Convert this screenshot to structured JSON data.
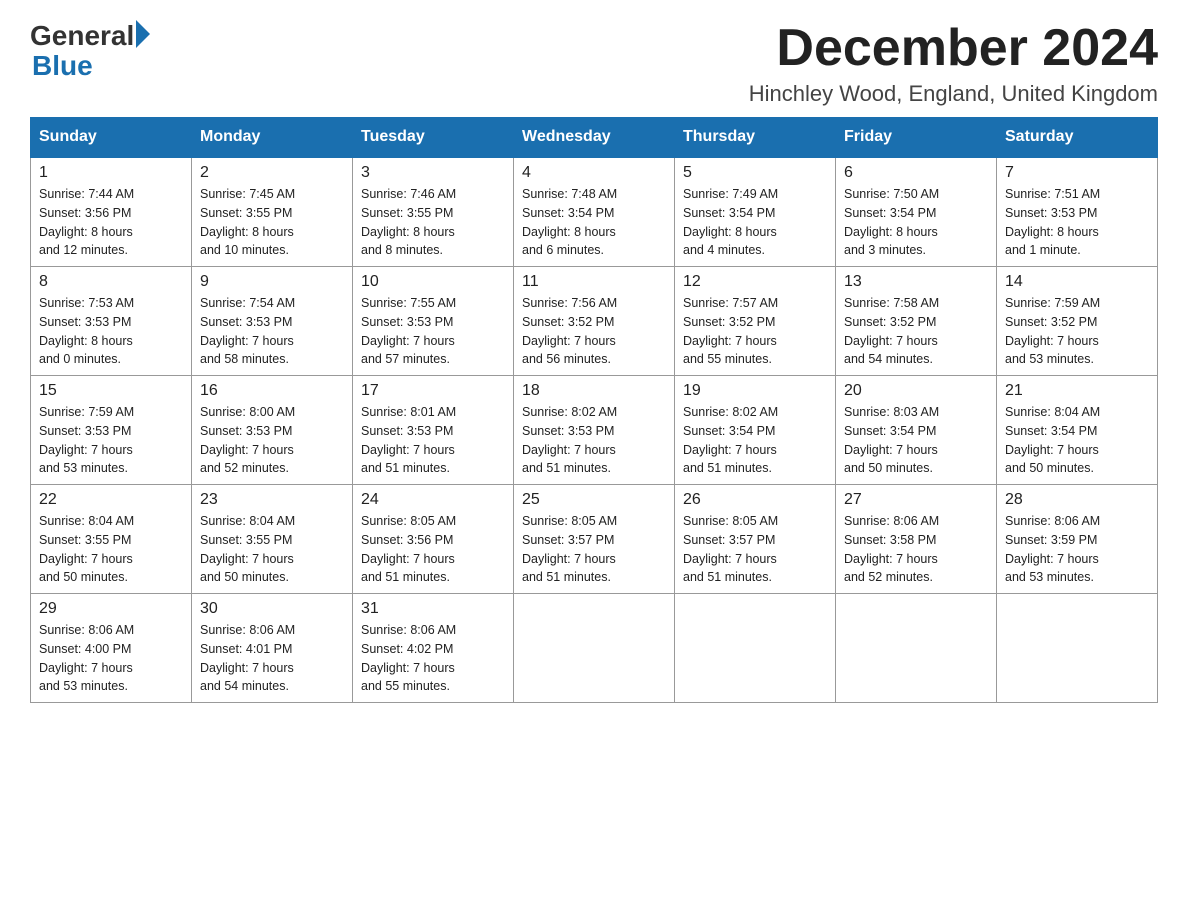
{
  "header": {
    "logo": {
      "general": "General",
      "blue": "Blue"
    },
    "title": "December 2024",
    "location": "Hinchley Wood, England, United Kingdom"
  },
  "columns": [
    "Sunday",
    "Monday",
    "Tuesday",
    "Wednesday",
    "Thursday",
    "Friday",
    "Saturday"
  ],
  "weeks": [
    [
      {
        "day": "1",
        "sunrise": "Sunrise: 7:44 AM",
        "sunset": "Sunset: 3:56 PM",
        "daylight": "Daylight: 8 hours",
        "daylight2": "and 12 minutes."
      },
      {
        "day": "2",
        "sunrise": "Sunrise: 7:45 AM",
        "sunset": "Sunset: 3:55 PM",
        "daylight": "Daylight: 8 hours",
        "daylight2": "and 10 minutes."
      },
      {
        "day": "3",
        "sunrise": "Sunrise: 7:46 AM",
        "sunset": "Sunset: 3:55 PM",
        "daylight": "Daylight: 8 hours",
        "daylight2": "and 8 minutes."
      },
      {
        "day": "4",
        "sunrise": "Sunrise: 7:48 AM",
        "sunset": "Sunset: 3:54 PM",
        "daylight": "Daylight: 8 hours",
        "daylight2": "and 6 minutes."
      },
      {
        "day": "5",
        "sunrise": "Sunrise: 7:49 AM",
        "sunset": "Sunset: 3:54 PM",
        "daylight": "Daylight: 8 hours",
        "daylight2": "and 4 minutes."
      },
      {
        "day": "6",
        "sunrise": "Sunrise: 7:50 AM",
        "sunset": "Sunset: 3:54 PM",
        "daylight": "Daylight: 8 hours",
        "daylight2": "and 3 minutes."
      },
      {
        "day": "7",
        "sunrise": "Sunrise: 7:51 AM",
        "sunset": "Sunset: 3:53 PM",
        "daylight": "Daylight: 8 hours",
        "daylight2": "and 1 minute."
      }
    ],
    [
      {
        "day": "8",
        "sunrise": "Sunrise: 7:53 AM",
        "sunset": "Sunset: 3:53 PM",
        "daylight": "Daylight: 8 hours",
        "daylight2": "and 0 minutes."
      },
      {
        "day": "9",
        "sunrise": "Sunrise: 7:54 AM",
        "sunset": "Sunset: 3:53 PM",
        "daylight": "Daylight: 7 hours",
        "daylight2": "and 58 minutes."
      },
      {
        "day": "10",
        "sunrise": "Sunrise: 7:55 AM",
        "sunset": "Sunset: 3:53 PM",
        "daylight": "Daylight: 7 hours",
        "daylight2": "and 57 minutes."
      },
      {
        "day": "11",
        "sunrise": "Sunrise: 7:56 AM",
        "sunset": "Sunset: 3:52 PM",
        "daylight": "Daylight: 7 hours",
        "daylight2": "and 56 minutes."
      },
      {
        "day": "12",
        "sunrise": "Sunrise: 7:57 AM",
        "sunset": "Sunset: 3:52 PM",
        "daylight": "Daylight: 7 hours",
        "daylight2": "and 55 minutes."
      },
      {
        "day": "13",
        "sunrise": "Sunrise: 7:58 AM",
        "sunset": "Sunset: 3:52 PM",
        "daylight": "Daylight: 7 hours",
        "daylight2": "and 54 minutes."
      },
      {
        "day": "14",
        "sunrise": "Sunrise: 7:59 AM",
        "sunset": "Sunset: 3:52 PM",
        "daylight": "Daylight: 7 hours",
        "daylight2": "and 53 minutes."
      }
    ],
    [
      {
        "day": "15",
        "sunrise": "Sunrise: 7:59 AM",
        "sunset": "Sunset: 3:53 PM",
        "daylight": "Daylight: 7 hours",
        "daylight2": "and 53 minutes."
      },
      {
        "day": "16",
        "sunrise": "Sunrise: 8:00 AM",
        "sunset": "Sunset: 3:53 PM",
        "daylight": "Daylight: 7 hours",
        "daylight2": "and 52 minutes."
      },
      {
        "day": "17",
        "sunrise": "Sunrise: 8:01 AM",
        "sunset": "Sunset: 3:53 PM",
        "daylight": "Daylight: 7 hours",
        "daylight2": "and 51 minutes."
      },
      {
        "day": "18",
        "sunrise": "Sunrise: 8:02 AM",
        "sunset": "Sunset: 3:53 PM",
        "daylight": "Daylight: 7 hours",
        "daylight2": "and 51 minutes."
      },
      {
        "day": "19",
        "sunrise": "Sunrise: 8:02 AM",
        "sunset": "Sunset: 3:54 PM",
        "daylight": "Daylight: 7 hours",
        "daylight2": "and 51 minutes."
      },
      {
        "day": "20",
        "sunrise": "Sunrise: 8:03 AM",
        "sunset": "Sunset: 3:54 PM",
        "daylight": "Daylight: 7 hours",
        "daylight2": "and 50 minutes."
      },
      {
        "day": "21",
        "sunrise": "Sunrise: 8:04 AM",
        "sunset": "Sunset: 3:54 PM",
        "daylight": "Daylight: 7 hours",
        "daylight2": "and 50 minutes."
      }
    ],
    [
      {
        "day": "22",
        "sunrise": "Sunrise: 8:04 AM",
        "sunset": "Sunset: 3:55 PM",
        "daylight": "Daylight: 7 hours",
        "daylight2": "and 50 minutes."
      },
      {
        "day": "23",
        "sunrise": "Sunrise: 8:04 AM",
        "sunset": "Sunset: 3:55 PM",
        "daylight": "Daylight: 7 hours",
        "daylight2": "and 50 minutes."
      },
      {
        "day": "24",
        "sunrise": "Sunrise: 8:05 AM",
        "sunset": "Sunset: 3:56 PM",
        "daylight": "Daylight: 7 hours",
        "daylight2": "and 51 minutes."
      },
      {
        "day": "25",
        "sunrise": "Sunrise: 8:05 AM",
        "sunset": "Sunset: 3:57 PM",
        "daylight": "Daylight: 7 hours",
        "daylight2": "and 51 minutes."
      },
      {
        "day": "26",
        "sunrise": "Sunrise: 8:05 AM",
        "sunset": "Sunset: 3:57 PM",
        "daylight": "Daylight: 7 hours",
        "daylight2": "and 51 minutes."
      },
      {
        "day": "27",
        "sunrise": "Sunrise: 8:06 AM",
        "sunset": "Sunset: 3:58 PM",
        "daylight": "Daylight: 7 hours",
        "daylight2": "and 52 minutes."
      },
      {
        "day": "28",
        "sunrise": "Sunrise: 8:06 AM",
        "sunset": "Sunset: 3:59 PM",
        "daylight": "Daylight: 7 hours",
        "daylight2": "and 53 minutes."
      }
    ],
    [
      {
        "day": "29",
        "sunrise": "Sunrise: 8:06 AM",
        "sunset": "Sunset: 4:00 PM",
        "daylight": "Daylight: 7 hours",
        "daylight2": "and 53 minutes."
      },
      {
        "day": "30",
        "sunrise": "Sunrise: 8:06 AM",
        "sunset": "Sunset: 4:01 PM",
        "daylight": "Daylight: 7 hours",
        "daylight2": "and 54 minutes."
      },
      {
        "day": "31",
        "sunrise": "Sunrise: 8:06 AM",
        "sunset": "Sunset: 4:02 PM",
        "daylight": "Daylight: 7 hours",
        "daylight2": "and 55 minutes."
      },
      null,
      null,
      null,
      null
    ]
  ]
}
